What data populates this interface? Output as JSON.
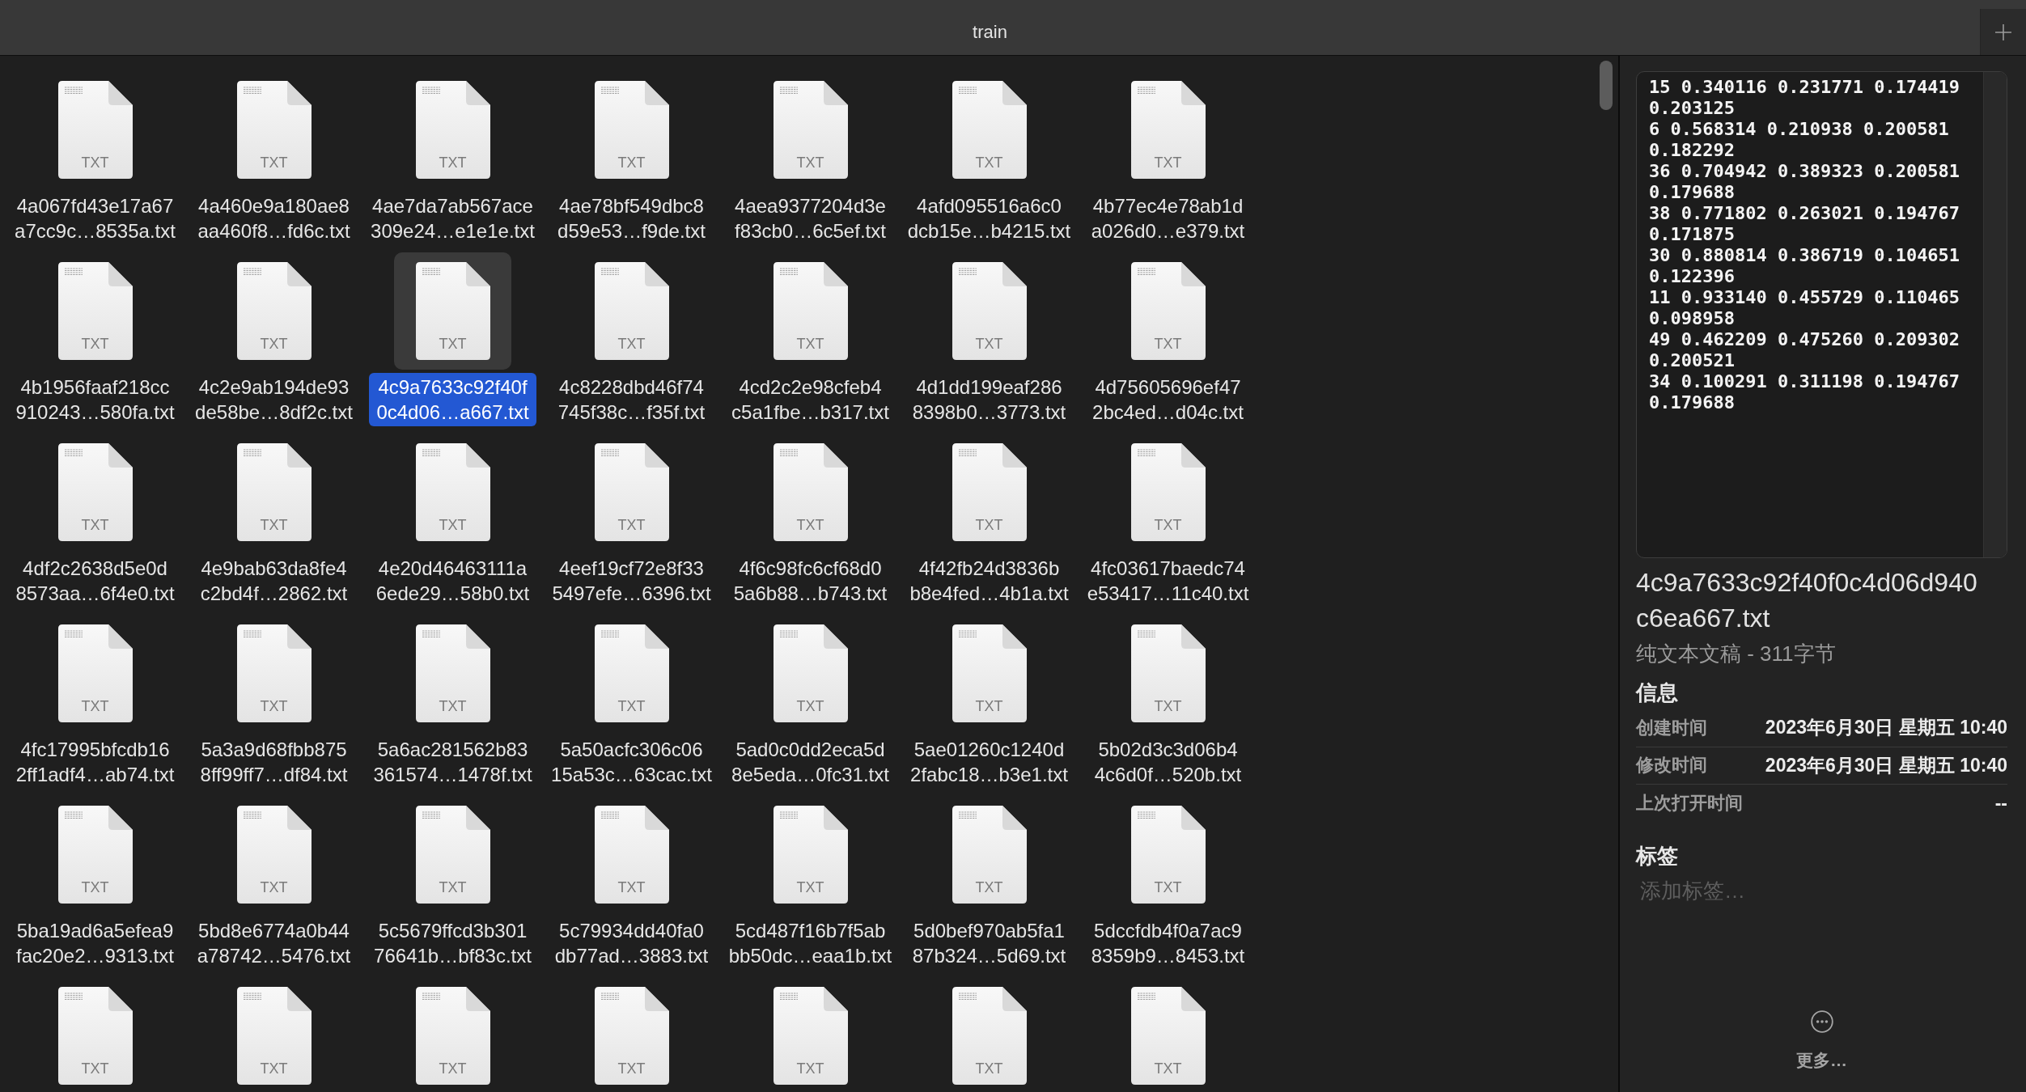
{
  "tab_bar": {
    "tab": {
      "label": "train"
    }
  },
  "files": [
    {
      "name": "4a067fd43e17a67\na7cc9c…8535a.txt",
      "type_label": "TXT",
      "selected": false
    },
    {
      "name": "4a460e9a180ae8\naa460f8…fd6c.txt",
      "type_label": "TXT",
      "selected": false
    },
    {
      "name": "4ae7da7ab567ace\n309e24…e1e1e.txt",
      "type_label": "TXT",
      "selected": false
    },
    {
      "name": "4ae78bf549dbc8\nd59e53…f9de.txt",
      "type_label": "TXT",
      "selected": false
    },
    {
      "name": "4aea9377204d3e\nf83cb0…6c5ef.txt",
      "type_label": "TXT",
      "selected": false
    },
    {
      "name": "4afd095516a6c0\ndcb15e…b4215.txt",
      "type_label": "TXT",
      "selected": false
    },
    {
      "name": "4b77ec4e78ab1d\na026d0…e379.txt",
      "type_label": "TXT",
      "selected": false
    },
    {
      "name": "4b1956faaf218cc\n910243…580fa.txt",
      "type_label": "TXT",
      "selected": false
    },
    {
      "name": "4c2e9ab194de93\nde58be…8df2c.txt",
      "type_label": "TXT",
      "selected": false
    },
    {
      "name": "4c9a7633c92f40f\n0c4d06…a667.txt",
      "type_label": "TXT",
      "selected": true
    },
    {
      "name": "4c8228dbd46f74\n745f38c…f35f.txt",
      "type_label": "TXT",
      "selected": false
    },
    {
      "name": "4cd2c2e98cfeb4\nc5a1fbe…b317.txt",
      "type_label": "TXT",
      "selected": false
    },
    {
      "name": "4d1dd199eaf286\n8398b0…3773.txt",
      "type_label": "TXT",
      "selected": false
    },
    {
      "name": "4d75605696ef47\n2bc4ed…d04c.txt",
      "type_label": "TXT",
      "selected": false
    },
    {
      "name": "4df2c2638d5e0d\n8573aa…6f4e0.txt",
      "type_label": "TXT",
      "selected": false
    },
    {
      "name": "4e9bab63da8fe4\nc2bd4f…2862.txt",
      "type_label": "TXT",
      "selected": false
    },
    {
      "name": "4e20d46463111a\n6ede29…58b0.txt",
      "type_label": "TXT",
      "selected": false
    },
    {
      "name": "4eef19cf72e8f33\n5497efe…6396.txt",
      "type_label": "TXT",
      "selected": false
    },
    {
      "name": "4f6c98fc6cf68d0\n5a6b88…b743.txt",
      "type_label": "TXT",
      "selected": false
    },
    {
      "name": "4f42fb24d3836b\nb8e4fed…4b1a.txt",
      "type_label": "TXT",
      "selected": false
    },
    {
      "name": "4fc03617baedc74\ne53417…11c40.txt",
      "type_label": "TXT",
      "selected": false
    },
    {
      "name": "4fc17995bfcdb16\n2ff1adf4…ab74.txt",
      "type_label": "TXT",
      "selected": false
    },
    {
      "name": "5a3a9d68fbb875\n8ff99ff7…df84.txt",
      "type_label": "TXT",
      "selected": false
    },
    {
      "name": "5a6ac281562b83\n361574…1478f.txt",
      "type_label": "TXT",
      "selected": false
    },
    {
      "name": "5a50acfc306c06\n15a53c…63cac.txt",
      "type_label": "TXT",
      "selected": false
    },
    {
      "name": "5ad0c0dd2eca5d\n8e5eda…0fc31.txt",
      "type_label": "TXT",
      "selected": false
    },
    {
      "name": "5ae01260c1240d\n2fabc18…b3e1.txt",
      "type_label": "TXT",
      "selected": false
    },
    {
      "name": "5b02d3c3d06b4\n4c6d0f…520b.txt",
      "type_label": "TXT",
      "selected": false
    },
    {
      "name": "5ba19ad6a5efea9\nfac20e2…9313.txt",
      "type_label": "TXT",
      "selected": false
    },
    {
      "name": "5bd8e6774a0b44\na78742…5476.txt",
      "type_label": "TXT",
      "selected": false
    },
    {
      "name": "5c5679ffcd3b301\n76641b…bf83c.txt",
      "type_label": "TXT",
      "selected": false
    },
    {
      "name": "5c79934dd40fa0\ndb77ad…3883.txt",
      "type_label": "TXT",
      "selected": false
    },
    {
      "name": "5cd487f16b7f5ab\nbb50dc…eaa1b.txt",
      "type_label": "TXT",
      "selected": false
    },
    {
      "name": "5d0bef970ab5fa1\n87b324…5d69.txt",
      "type_label": "TXT",
      "selected": false
    },
    {
      "name": "5dccfdb4f0a7ac9\n8359b9…8453.txt",
      "type_label": "TXT",
      "selected": false
    },
    {
      "type_label": "TXT",
      "selected": false
    },
    {
      "type_label": "TXT",
      "selected": false
    },
    {
      "type_label": "TXT",
      "selected": false
    },
    {
      "type_label": "TXT",
      "selected": false
    },
    {
      "type_label": "TXT",
      "selected": false
    },
    {
      "type_label": "TXT",
      "selected": false
    },
    {
      "type_label": "TXT",
      "selected": false
    }
  ],
  "preview": {
    "lines": [
      "15 0.340116 0.231771 0.174419 0.203125",
      "6 0.568314 0.210938 0.200581 0.182292",
      "36 0.704942 0.389323 0.200581 0.179688",
      "38 0.771802 0.263021 0.194767 0.171875",
      "30 0.880814 0.386719 0.104651 0.122396",
      "11 0.933140 0.455729 0.110465 0.098958",
      "49 0.462209 0.475260 0.209302 0.200521",
      "34 0.100291 0.311198 0.194767 0.179688"
    ]
  },
  "inspector": {
    "title": "4c9a7633c92f40f0c4d06d940\nc6ea667.txt",
    "subtitle": "纯文本文稿 - 311字节",
    "info": {
      "heading": "信息",
      "rows": [
        {
          "label": "创建时间",
          "value": "2023年6月30日 星期五 10:40"
        },
        {
          "label": "修改时间",
          "value": "2023年6月30日 星期五 10:40"
        },
        {
          "label": "上次打开时间",
          "value": "--"
        }
      ]
    },
    "tags": {
      "heading": "标签",
      "placeholder": "添加标签…"
    },
    "more_button": {
      "label": "更多…"
    }
  }
}
